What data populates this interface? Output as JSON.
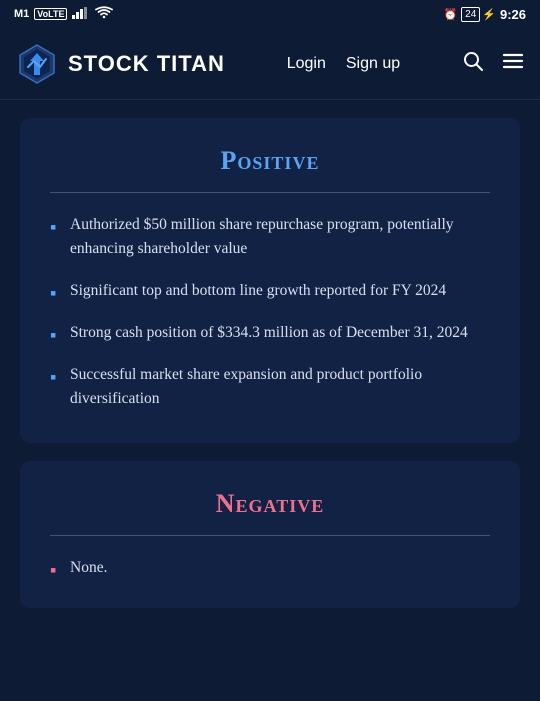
{
  "status": {
    "carrier": "M1",
    "volte": "VoLTE",
    "signal_bars": "▐▐▐",
    "wifi": "WiFi",
    "alarm": "⏰",
    "battery_num": "24",
    "charging": "⚡",
    "time": "9:26"
  },
  "navbar": {
    "brand_name": "STOCK TITAN",
    "login_label": "Login",
    "signup_label": "Sign up"
  },
  "positive": {
    "title": "Positive",
    "items": [
      "Authorized $50 million share repurchase program, potentially enhancing shareholder value",
      "Significant top and bottom line growth reported for FY 2024",
      "Strong cash position of $334.3 million as of December 31, 2024",
      "Successful market share expansion and product portfolio diversification"
    ]
  },
  "negative": {
    "title": "Negative",
    "items": [
      "None."
    ]
  }
}
